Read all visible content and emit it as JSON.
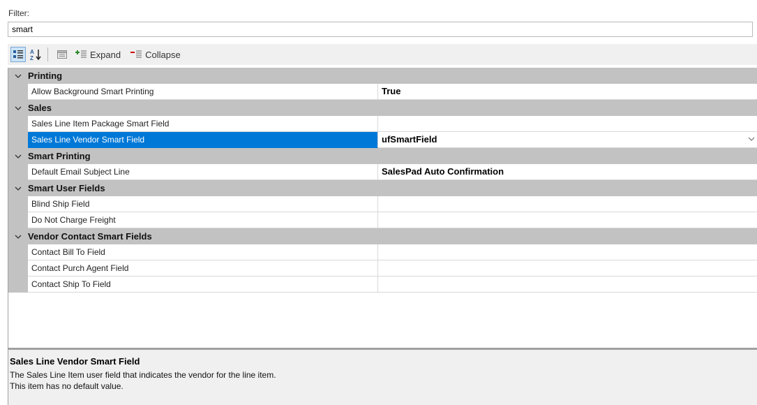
{
  "filter": {
    "label": "Filter:",
    "value": "smart"
  },
  "toolbar": {
    "categorized_icon": "categorized-icon",
    "alphabetical_icon": "sort-alphabetical-icon",
    "property_pages_icon": "property-pages-icon",
    "expand_label": "Expand",
    "collapse_label": "Collapse"
  },
  "grid": {
    "categories": [
      {
        "label": "Printing",
        "properties": [
          {
            "name": "Allow Background Smart Printing",
            "value": "True"
          }
        ]
      },
      {
        "label": "Sales",
        "properties": [
          {
            "name": "Sales Line Item Package Smart Field",
            "value": ""
          },
          {
            "name": "Sales Line Vendor Smart Field",
            "value": "ufSmartField"
          }
        ]
      },
      {
        "label": "Smart Printing",
        "properties": [
          {
            "name": "Default Email Subject Line",
            "value": "SalesPad Auto Confirmation"
          }
        ]
      },
      {
        "label": "Smart User Fields",
        "properties": [
          {
            "name": "Blind Ship Field",
            "value": ""
          },
          {
            "name": "Do Not Charge Freight",
            "value": ""
          }
        ]
      },
      {
        "label": "Vendor Contact Smart Fields",
        "properties": [
          {
            "name": "Contact Bill To Field",
            "value": ""
          },
          {
            "name": "Contact Purch Agent Field",
            "value": ""
          },
          {
            "name": "Contact Ship To Field",
            "value": ""
          }
        ]
      }
    ]
  },
  "description": {
    "title": "Sales Line Vendor Smart Field",
    "line1": "The Sales Line Item user field that indicates the vendor for the line item.",
    "line2": "This item has no default value."
  },
  "colors": {
    "selection": "#0078d7",
    "category_bg": "#c2c2c2",
    "expand_accent": "#2e8b2e",
    "collapse_accent": "#d00000"
  }
}
